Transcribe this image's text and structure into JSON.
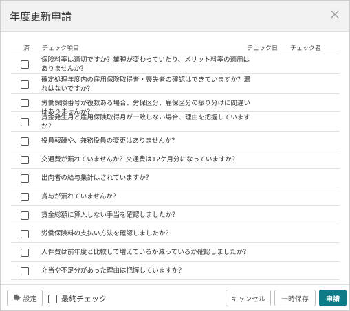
{
  "dialog": {
    "title": "年度更新申請"
  },
  "table": {
    "headers": {
      "done": "済",
      "item": "チェック項目",
      "date": "チェック日",
      "checker": "チェック者"
    },
    "rows": [
      {
        "text": "保険料率は適切ですか？業種が変わっていたり、メリット料率の適用はありませんか？",
        "checked": false
      },
      {
        "text": "確定処理年度内の雇用保険取得者・喪失者の確認はできていますか？漏れはないですか？",
        "checked": false
      },
      {
        "text": "労働保険番号が複数ある場合、労保区分、雇保区分の振り分けに間違いはありませんか？",
        "checked": false
      },
      {
        "text": "賃金発生月と雇用保険取得月が一致しない場合、理由を把握していますか？",
        "checked": false
      },
      {
        "text": "役員報酬や、兼務役員の変更はありませんか？",
        "checked": false
      },
      {
        "text": "交通費が漏れていませんか？交通費は12ケ月分になっていますか？",
        "checked": false
      },
      {
        "text": "出向者の給与集計はされていますか？",
        "checked": false
      },
      {
        "text": "賞与が漏れていませんか？",
        "checked": false
      },
      {
        "text": "賃金総額に算入しない手当を確認しましたか？",
        "checked": false
      },
      {
        "text": "労働保険料の支払い方法を確認しましたか？",
        "checked": false
      },
      {
        "text": "人件費は前年度と比較して増えているか減っているか確認しましたか？",
        "checked": false
      },
      {
        "text": "充当や不足分があった理由は把握していますか？",
        "checked": false
      }
    ]
  },
  "footer": {
    "settings_label": "設定",
    "final_check_label": "最終チェック",
    "cancel_label": "キャンセル",
    "temp_save_label": "一時保存",
    "apply_label": "申請"
  },
  "colors": {
    "primary": "#0f7b86",
    "header_bg": "#f2f2f2"
  }
}
